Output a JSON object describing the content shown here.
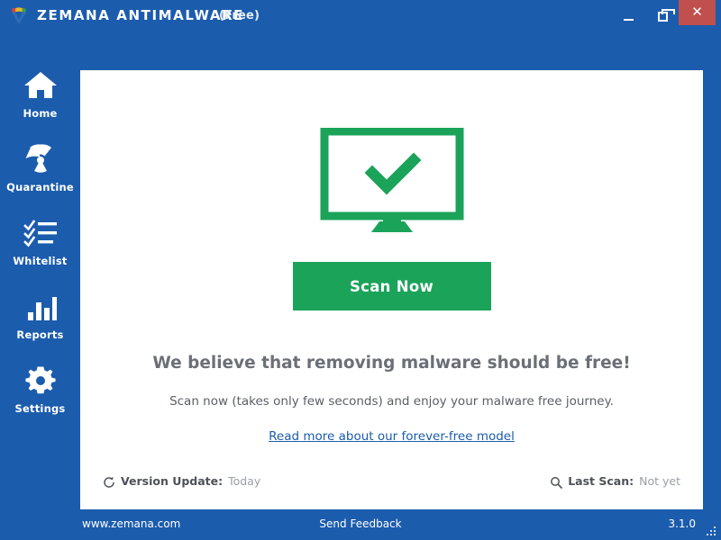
{
  "window": {
    "title": "ZEMANA ANTIMALWARE",
    "edition": "(Free)",
    "logo_icon": "zemana-shield-logo",
    "controls": {
      "minimize": "minimize-icon",
      "maximize": "maximize-icon",
      "close": "✕"
    }
  },
  "colors": {
    "brand_blue": "#1b5cad",
    "accent_green": "#1ba35a",
    "close_red": "#c0504d",
    "panel_white": "#ffffff",
    "muted_text": "#9aa0a6",
    "link_blue": "#1b5cad"
  },
  "sidebar": {
    "items": [
      {
        "label": "Home",
        "icon": "home-icon"
      },
      {
        "label": "Quarantine",
        "icon": "radiation-icon"
      },
      {
        "label": "Whitelist",
        "icon": "checklist-icon"
      },
      {
        "label": "Reports",
        "icon": "bar-chart-icon"
      },
      {
        "label": "Settings",
        "icon": "gear-icon"
      }
    ]
  },
  "main": {
    "hero_icon": "monitor-check-icon",
    "scan_button": "Scan Now",
    "headline": "We believe that removing malware should be free!",
    "subline": "Scan now (takes only few seconds) and enjoy your malware free journey.",
    "read_more_link": "Read more about our forever-free model",
    "status": {
      "version_update_icon": "refresh-icon",
      "version_update_label": "Version Update:",
      "version_update_value": "Today",
      "last_scan_icon": "search-icon",
      "last_scan_label": "Last Scan:",
      "last_scan_value": "Not yet"
    }
  },
  "footer": {
    "site": "www.zemana.com",
    "feedback": "Send Feedback",
    "version": "3.1.0",
    "grip_icon": "resize-grip-icon"
  }
}
